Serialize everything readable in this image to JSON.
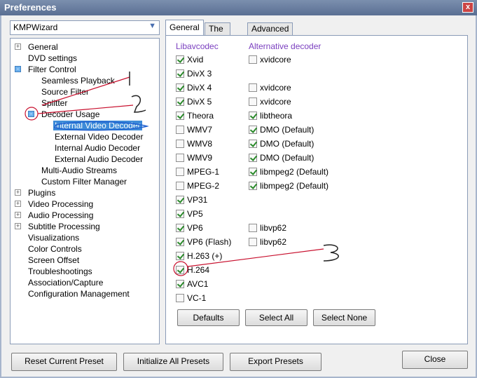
{
  "window": {
    "title": "Preferences",
    "close_glyph": "x"
  },
  "preset": {
    "value": "KMPWizard",
    "arrow": "▼"
  },
  "tree": {
    "general": "General",
    "dvd": "DVD settings",
    "filter_control": "Filter Control",
    "seamless": "Seamless Playback",
    "source_filter": "Source Filter",
    "splitter": "Splitter",
    "decoder_usage": "Decoder Usage",
    "internal_video": "Internal Video Decoder",
    "external_video": "External Video Decoder",
    "internal_audio": "Internal Audio Decoder",
    "external_audio": "External Audio Decoder",
    "multi_audio": "Multi-Audio Streams",
    "custom_filter": "Custom Filter Manager",
    "plugins": "Plugins",
    "video_processing": "Video Processing",
    "audio_processing": "Audio Processing",
    "subtitle_processing": "Subtitle Processing",
    "visualizations": "Visualizations",
    "color_controls": "Color Controls",
    "screen_offset": "Screen Offset",
    "troubleshootings": "Troubleshootings",
    "association": "Association/Capture",
    "configuration": "Configuration Management"
  },
  "tabs": {
    "general": "General",
    "the_rest": "The Rest",
    "advanced": "Advanced"
  },
  "columns": {
    "libavcodec": "Libavcodec",
    "alternative": "Alternative decoder"
  },
  "codecs": [
    {
      "name": "Xvid",
      "checked": true
    },
    {
      "name": "DivX 3",
      "checked": true
    },
    {
      "name": "DivX 4",
      "checked": true
    },
    {
      "name": "DivX 5",
      "checked": true
    },
    {
      "name": "Theora",
      "checked": true
    },
    {
      "name": "WMV7",
      "checked": false
    },
    {
      "name": "WMV8",
      "checked": false
    },
    {
      "name": "WMV9",
      "checked": false
    },
    {
      "name": "MPEG-1",
      "checked": false
    },
    {
      "name": "MPEG-2",
      "checked": false
    },
    {
      "name": "VP31",
      "checked": true
    },
    {
      "name": "VP5",
      "checked": true
    },
    {
      "name": "VP6",
      "checked": true
    },
    {
      "name": "VP6 (Flash)",
      "checked": true
    },
    {
      "name": "H.263 (+)",
      "checked": true
    },
    {
      "name": "H.264",
      "checked": true
    },
    {
      "name": "AVC1",
      "checked": true
    },
    {
      "name": "VC-1",
      "checked": false
    }
  ],
  "alternatives": [
    {
      "row": 0,
      "name": "xvidcore",
      "checked": false
    },
    {
      "row": 2,
      "name": "xvidcore",
      "checked": false
    },
    {
      "row": 3,
      "name": "xvidcore",
      "checked": false
    },
    {
      "row": 4,
      "name": "libtheora",
      "checked": true
    },
    {
      "row": 5,
      "name": "DMO (Default)",
      "checked": true
    },
    {
      "row": 6,
      "name": "DMO (Default)",
      "checked": true
    },
    {
      "row": 7,
      "name": "DMO (Default)",
      "checked": true
    },
    {
      "row": 8,
      "name": "libmpeg2 (Default)",
      "checked": true
    },
    {
      "row": 9,
      "name": "libmpeg2 (Default)",
      "checked": true
    },
    {
      "row": 12,
      "name": "libvp62",
      "checked": false
    },
    {
      "row": 13,
      "name": "libvp62",
      "checked": false
    }
  ],
  "panel_buttons": {
    "defaults": "Defaults",
    "select_all": "Select All",
    "select_none": "Select None"
  },
  "bottom_buttons": {
    "reset": "Reset Current Preset",
    "initialize": "Initialize All Presets",
    "export": "Export Presets",
    "close": "Close"
  },
  "annotations": {
    "mark1": "1",
    "mark2": "2",
    "mark3": "3"
  }
}
